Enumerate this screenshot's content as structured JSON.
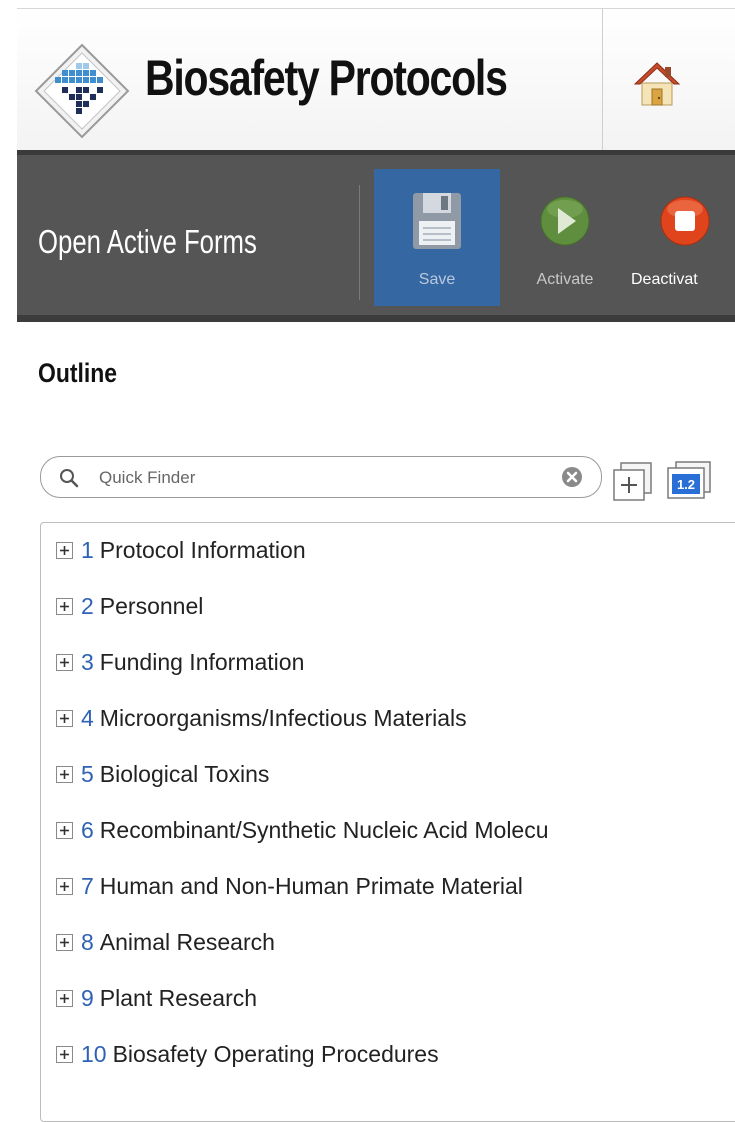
{
  "header": {
    "app_title": "Biosafety Protocols",
    "logo_icon": "biosafety-logo-icon",
    "home_icon": "home-icon"
  },
  "toolbar": {
    "form_title": "Open Active Forms",
    "save_label": "Save",
    "activate_label": "Activate",
    "deactivate_label": "Deactivat",
    "save_icon": "floppy-disk-icon",
    "activate_icon": "play-icon",
    "deactivate_icon": "stop-icon"
  },
  "outline": {
    "heading": "Outline",
    "finder_placeholder": "Quick Finder",
    "finder_value": "",
    "items": [
      {
        "num": "1",
        "label": "Protocol Information"
      },
      {
        "num": "2",
        "label": "Personnel"
      },
      {
        "num": "3",
        "label": "Funding Information"
      },
      {
        "num": "4",
        "label": "Microorganisms/Infectious Materials"
      },
      {
        "num": "5",
        "label": "Biological Toxins"
      },
      {
        "num": "6",
        "label": "Recombinant/Synthetic Nucleic Acid Molecu"
      },
      {
        "num": "7",
        "label": "Human and Non-Human Primate Material"
      },
      {
        "num": "8",
        "label": "Animal Research"
      },
      {
        "num": "9",
        "label": "Plant Research"
      },
      {
        "num": "10",
        "label": "Biosafety Operating Procedures"
      }
    ]
  },
  "colors": {
    "toolbar_bg": "#555555",
    "save_bg": "#3567a3",
    "item_number": "#2f62b5",
    "activate_green": "#5f8f3e",
    "deactivate_red": "#e0441d"
  }
}
